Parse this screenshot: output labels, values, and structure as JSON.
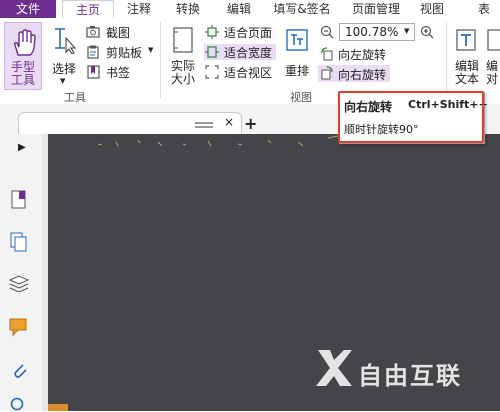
{
  "menu": {
    "tabs": [
      "文件",
      "主页",
      "注释",
      "转换",
      "编辑",
      "填写&签名",
      "页面管理",
      "视图",
      "表"
    ]
  },
  "ribbon": {
    "hand_tool": [
      "手型",
      "工具"
    ],
    "select": "选择",
    "screenshot": "截图",
    "clipboard": "剪贴板",
    "bookmark": "书签",
    "tools_group": "工具",
    "actual_size": [
      "实际",
      "大小"
    ],
    "fit_page": "适合页面",
    "fit_width": "适合宽度",
    "fit_view": "适合视区",
    "reflow": "重排",
    "zoom_value": "100.78%",
    "rotate_left": "向左旋转",
    "rotate_right": "向右旋转",
    "view_group": "视图",
    "edit_text": [
      "编辑",
      "文本"
    ],
    "edit_obj_partial": [
      "编",
      "对"
    ]
  },
  "tooltip": {
    "title": "向右旋转",
    "shortcut": "Ctrl+Shift++",
    "description": "顺时针旋转90°"
  },
  "tabstrip": {
    "add_label": "+"
  },
  "watermark": {
    "text": "自由互联"
  },
  "colors": {
    "accent": "#6d2e8f",
    "highlight": "#eadbf4",
    "viewer_bg": "#444548",
    "tooltip_border": "#e23b2e"
  }
}
